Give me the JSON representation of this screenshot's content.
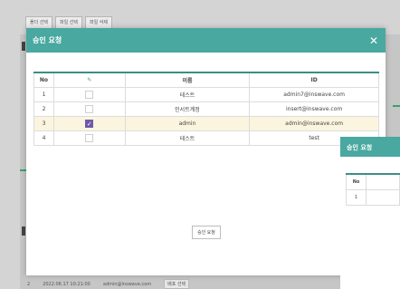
{
  "background": {
    "toolbar": [
      "폴더 선택",
      "파일 선택",
      "파일 삭제"
    ],
    "bottom_row": {
      "index": "2",
      "timestamp": "2022.06.17 10:21:00",
      "email": "admin@inswave.com",
      "action": "배포 선택"
    }
  },
  "modal": {
    "title": "승인 요청",
    "close_icon": "close-icon",
    "columns": {
      "no": "No",
      "check": "pencil-icon",
      "name": "이름",
      "id": "ID"
    },
    "rows": [
      {
        "no": "1",
        "checked": false,
        "name": "테스트",
        "id": "admin7@inswave.com"
      },
      {
        "no": "2",
        "checked": false,
        "name": "인서트계정",
        "id": "insert@inswave.com"
      },
      {
        "no": "3",
        "checked": true,
        "name": "admin",
        "id": "admin@inswave.com"
      },
      {
        "no": "4",
        "checked": false,
        "name": "테스트",
        "id": "test"
      }
    ],
    "approve_button": "승인 요청"
  },
  "modal2": {
    "title": "승인 요청",
    "columns": {
      "no": "No"
    },
    "rows": [
      {
        "no": "1"
      }
    ]
  },
  "colors": {
    "header": "#49a8a0",
    "selected_row": "#fbf5df",
    "checkbox_on": "#6f59a8"
  }
}
